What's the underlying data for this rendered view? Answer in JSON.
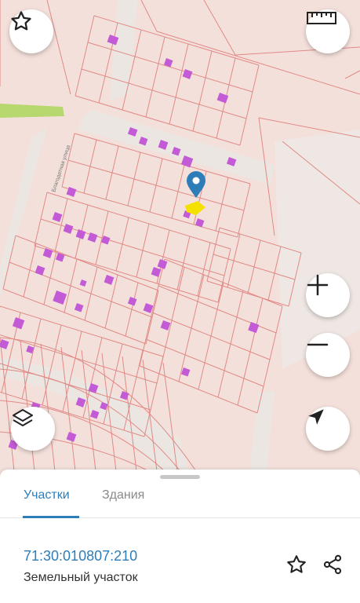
{
  "map": {
    "street_label": "Благодатная улица",
    "colors": {
      "background": "#f4e0db",
      "parcel_border": "#e08a86",
      "building": "#c45bd6",
      "road": "#eee8e4",
      "selected_parcel": "#f5e100",
      "marker": "#2d7db8",
      "green": "#b7d86f"
    }
  },
  "controls": {
    "favorite": "star-icon",
    "ruler": "ruler-icon",
    "zoom_in": "plus-icon",
    "zoom_out": "minus-icon",
    "layers": "layers-icon",
    "locate": "navigation-arrow-icon"
  },
  "sheet": {
    "tabs": [
      {
        "label": "Участки",
        "active": true
      },
      {
        "label": "Здания",
        "active": false
      }
    ],
    "cadastral_number": "71:30:010807:210",
    "parcel_type": "Земельный участок"
  }
}
